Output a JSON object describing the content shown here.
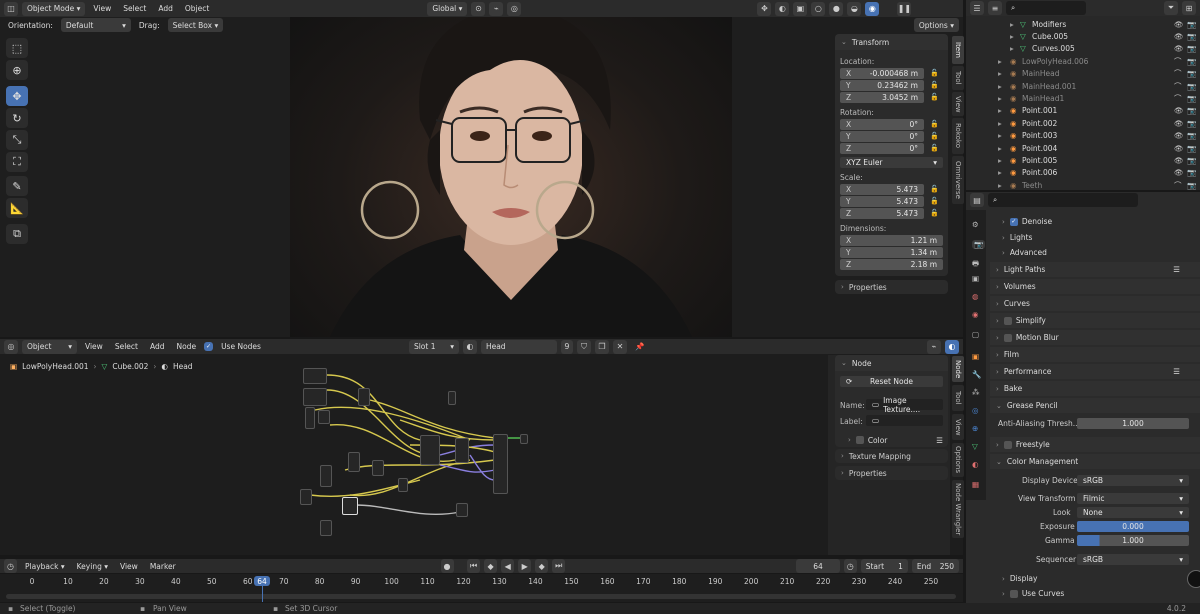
{
  "viewport_header": {
    "mode": "Object Mode",
    "menus": [
      "View",
      "Select",
      "Add",
      "Object"
    ],
    "transform_space": "Global",
    "options_label": "Options"
  },
  "tool_header": {
    "orientation_label": "Orientation:",
    "orientation_value": "Default",
    "drag_label": "Drag:",
    "drag_value": "Select Box"
  },
  "transform_panel": {
    "title": "Transform",
    "location_label": "Location:",
    "location": {
      "x": "-0.000468 m",
      "y": "0.23462 m",
      "z": "3.0452 m"
    },
    "rotation_label": "Rotation:",
    "rotation": {
      "x": "0°",
      "y": "0°",
      "z": "0°"
    },
    "rotation_mode": "XYZ Euler",
    "scale_label": "Scale:",
    "scale": {
      "x": "5.473",
      "y": "5.473",
      "z": "5.473"
    },
    "dimensions_label": "Dimensions:",
    "dimensions": {
      "x": "1.21 m",
      "y": "1.34 m",
      "z": "2.18 m"
    },
    "axis_x": "X",
    "axis_y": "Y",
    "axis_z": "Z",
    "properties_label": "Properties"
  },
  "viewport_tabs": [
    "Item",
    "Tool",
    "View",
    "Rokoko",
    "Omniverse"
  ],
  "node_header": {
    "object_label": "Object",
    "menus": [
      "View",
      "Select",
      "Add",
      "Node"
    ],
    "use_nodes_label": "Use Nodes",
    "use_nodes_checked": true,
    "slot": "Slot 1",
    "material": "Head",
    "user_count": "9"
  },
  "breadcrumb": {
    "object": "LowPolyHead.001",
    "mesh": "Cube.002",
    "material": "Head"
  },
  "node_panel": {
    "title": "Node",
    "reset_label": "Reset Node",
    "name_label": "Name:",
    "name_value": "Image Texture....",
    "label_label": "Label:",
    "label_value": "",
    "color_label": "Color",
    "texture_mapping_label": "Texture Mapping",
    "properties_label": "Properties"
  },
  "node_tabs": [
    "Node",
    "Tool",
    "View",
    "Options",
    "Node Wrangler"
  ],
  "outliner": {
    "items": [
      {
        "name": "Modifiers",
        "indent": 3,
        "dim": false
      },
      {
        "name": "Cube.005",
        "indent": 3,
        "dim": false
      },
      {
        "name": "Curves.005",
        "indent": 3,
        "dim": false
      },
      {
        "name": "LowPolyHead.006",
        "indent": 2,
        "dim": true
      },
      {
        "name": "MainHead",
        "indent": 2,
        "dim": true
      },
      {
        "name": "MainHead.001",
        "indent": 2,
        "dim": true
      },
      {
        "name": "MainHead1",
        "indent": 2,
        "dim": true
      },
      {
        "name": "Point.001",
        "indent": 2,
        "dim": false
      },
      {
        "name": "Point.002",
        "indent": 2,
        "dim": false
      },
      {
        "name": "Point.003",
        "indent": 2,
        "dim": false
      },
      {
        "name": "Point.004",
        "indent": 2,
        "dim": false
      },
      {
        "name": "Point.005",
        "indent": 2,
        "dim": false
      },
      {
        "name": "Point.006",
        "indent": 2,
        "dim": false
      },
      {
        "name": "Teeth",
        "indent": 2,
        "dim": true
      }
    ]
  },
  "properties": {
    "denoise_label": "Denoise",
    "lights_label": "Lights",
    "advanced_label": "Advanced",
    "light_paths_label": "Light Paths",
    "volumes_label": "Volumes",
    "curves_label": "Curves",
    "simplify_label": "Simplify",
    "motion_blur_label": "Motion Blur",
    "film_label": "Film",
    "performance_label": "Performance",
    "bake_label": "Bake",
    "grease_pencil_label": "Grease Pencil",
    "aa_threshold_label": "Anti-Aliasing Thresh...",
    "aa_threshold_value": "1.000",
    "freestyle_label": "Freestyle",
    "color_management_label": "Color Management",
    "display_device_label": "Display Device",
    "display_device_value": "sRGB",
    "view_transform_label": "View Transform",
    "view_transform_value": "Filmic",
    "look_label": "Look",
    "look_value": "None",
    "exposure_label": "Exposure",
    "exposure_value": "0.000",
    "gamma_label": "Gamma",
    "gamma_value": "1.000",
    "sequencer_label": "Sequencer",
    "sequencer_value": "sRGB",
    "display_label": "Display",
    "use_curves_label": "Use Curves"
  },
  "timeline": {
    "menus": [
      "Playback",
      "Keying",
      "View",
      "Marker"
    ],
    "current_frame": "64",
    "start_label": "Start",
    "start_value": "1",
    "end_label": "End",
    "end_value": "250",
    "ticks": [
      "0",
      "10",
      "20",
      "30",
      "40",
      "50",
      "60",
      "70",
      "80",
      "90",
      "100",
      "110",
      "120",
      "130",
      "140",
      "150",
      "160",
      "170",
      "180",
      "190",
      "200",
      "210",
      "220",
      "230",
      "240",
      "250"
    ]
  },
  "status_bar": {
    "select": "Select (Toggle)",
    "pan": "Pan View",
    "cursor": "Set 3D Cursor",
    "version": "4.0.2"
  },
  "colors": {
    "accent": "#4772b3",
    "bg": "#181818",
    "panel": "#2b2b2b",
    "frame_marker": "#4772b3"
  }
}
